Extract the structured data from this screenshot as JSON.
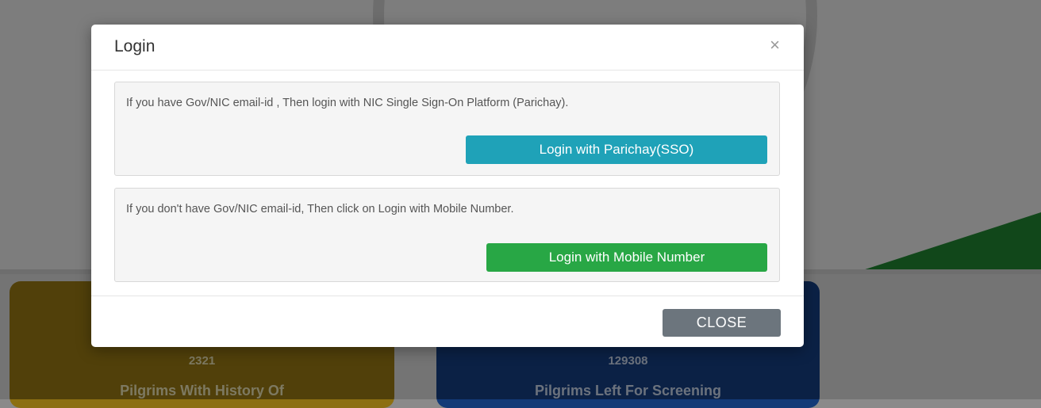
{
  "background": {
    "cards": [
      {
        "count": "2321",
        "label": "Pilgrims With History Of"
      },
      {
        "count": "129308",
        "label": "Pilgrims Left For Screening"
      }
    ]
  },
  "modal": {
    "title": "Login",
    "close_icon": "×",
    "sso_section": {
      "text": "If you have Gov/NIC email-id , Then login with NIC Single Sign-On Platform (Parichay).",
      "button": "Login with Parichay(SSO)"
    },
    "mobile_section": {
      "text": "If you don't have Gov/NIC email-id, Then click on Login with Mobile Number.",
      "button": "Login with Mobile Number"
    },
    "footer": {
      "close_button": "CLOSE"
    }
  },
  "colors": {
    "sso_button": "#1fa2b8",
    "mobile_button": "#28a745",
    "close_button": "#6c757d",
    "card_gold": "#8c6f12",
    "card_blue": "#133a77"
  }
}
